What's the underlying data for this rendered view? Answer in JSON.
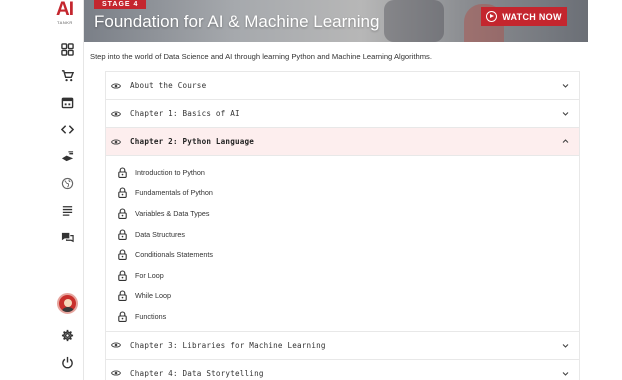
{
  "app": {
    "logo_text": "AI",
    "logo_subtext": "TANKR"
  },
  "sidebar": {
    "items": [
      {
        "icon": "dashboard-icon"
      },
      {
        "icon": "cart-icon"
      },
      {
        "icon": "calendar-icon"
      },
      {
        "icon": "code-icon"
      },
      {
        "icon": "learning-icon"
      },
      {
        "icon": "globe-icon"
      },
      {
        "icon": "list-icon"
      },
      {
        "icon": "chat-icon"
      }
    ],
    "bottom": [
      {
        "icon": "avatar"
      },
      {
        "icon": "gear-icon"
      },
      {
        "icon": "power-icon"
      }
    ]
  },
  "banner": {
    "stage": "STAGE 4",
    "title": "Foundation for AI & Machine Learning",
    "watch_label": "WATCH NOW"
  },
  "intro": "Step into the world of Data Science and AI through learning Python and Machine Learning Algorithms.",
  "accordion": {
    "sections": [
      {
        "label": "About the Course",
        "open": false
      },
      {
        "label": "Chapter 1: Basics of AI",
        "open": false
      },
      {
        "label": "Chapter 2: Python Language",
        "open": true
      },
      {
        "label": "Chapter 3: Libraries for Machine Learning",
        "open": false
      },
      {
        "label": "Chapter 4: Data Storytelling",
        "open": false
      }
    ],
    "lessons": [
      "Introduction to Python",
      "Fundamentals of Python",
      "Variables & Data Types",
      "Data Structures",
      "Conditionals Statements",
      "For Loop",
      "While Loop",
      "Functions"
    ]
  },
  "colors": {
    "accent": "#c4262e",
    "open_bg": "#fdeeee"
  }
}
